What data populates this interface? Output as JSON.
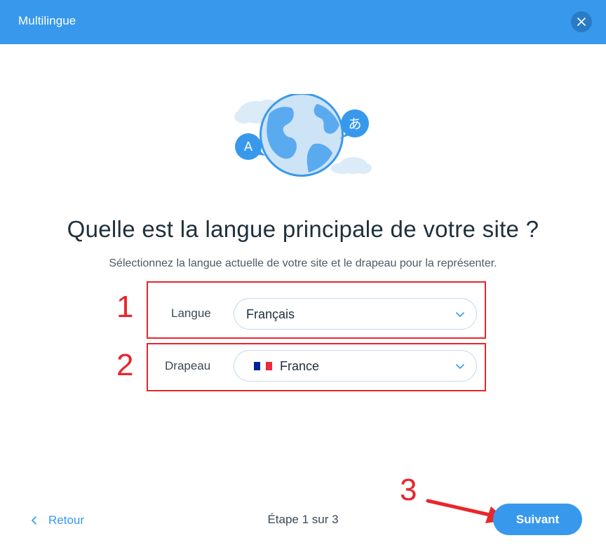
{
  "header": {
    "title": "Multilingue"
  },
  "illustration": {
    "bubble_left": "A",
    "bubble_right": "あ"
  },
  "main": {
    "title": "Quelle est la langue principale de votre site ?",
    "subtitle": "Sélectionnez la langue actuelle de votre site et le drapeau pour la représenter.",
    "language_label": "Langue",
    "language_value": "Français",
    "flag_label": "Drapeau",
    "flag_value": "France",
    "flag_colors": [
      "#002395",
      "#ffffff",
      "#ed2939"
    ]
  },
  "annotations": [
    "1",
    "2",
    "3"
  ],
  "footer": {
    "back_label": "Retour",
    "step_text": "Étape 1 sur 3",
    "next_label": "Suivant"
  },
  "colors": {
    "accent": "#3899ec",
    "annotation": "#e8262c",
    "title": "#20303c"
  }
}
